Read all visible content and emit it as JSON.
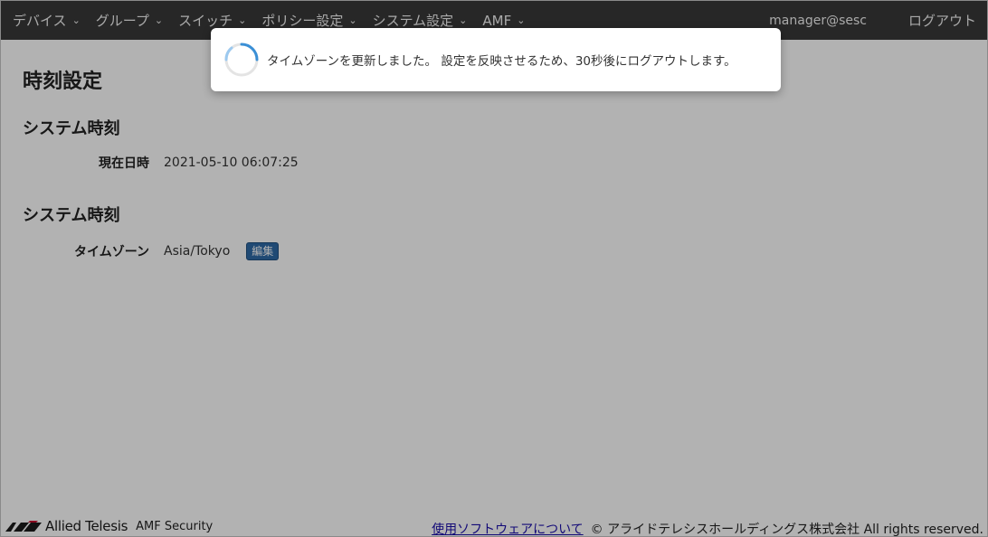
{
  "nav": {
    "items": [
      {
        "label": "デバイス"
      },
      {
        "label": "グループ"
      },
      {
        "label": "スイッチ"
      },
      {
        "label": "ポリシー設定"
      },
      {
        "label": "システム設定"
      },
      {
        "label": "AMF"
      }
    ],
    "user": "manager@sesc",
    "logout": "ログアウト"
  },
  "page": {
    "title": "時刻設定",
    "sections": [
      {
        "title": "システム時刻",
        "label": "現在日時",
        "value": "2021-05-10 06:07:25"
      },
      {
        "title": "システム時刻",
        "label": "タイムゾーン",
        "value": "Asia/Tokyo",
        "button": "編集"
      }
    ]
  },
  "toast": {
    "message": "タイムゾーンを更新しました。 設定を反映させるため、30秒後にログアウトします。"
  },
  "footer": {
    "brand": "Allied Telesis",
    "product": "AMF Security",
    "link": "使用ソフトウェアについて",
    "copyright": "© アライドテレシスホールディングス株式会社 All rights reserved."
  },
  "colors": {
    "navbar": "#383838",
    "accent": "#2f6aa6",
    "spinner": "#3a8fd6"
  }
}
